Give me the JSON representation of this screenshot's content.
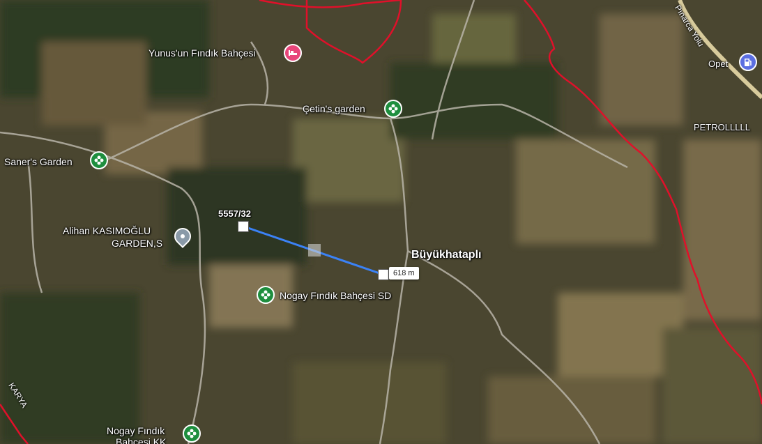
{
  "map": {
    "village_label": "Büyükhataplı",
    "parcel_label": "5557/32",
    "measurement": {
      "distance": "618 m"
    },
    "places": [
      {
        "name": "Yunus'un Fındık Bahçesi",
        "icon": "bed-icon",
        "color": "#e8457a"
      },
      {
        "name": "Çetin's garden",
        "icon": "flower-icon",
        "color": "#1e8e3e"
      },
      {
        "name": "Saner's Garden",
        "icon": "flower-icon",
        "color": "#1e8e3e"
      },
      {
        "name": "Alihan KASIMOĞLU",
        "line2": "GARDEN,S",
        "icon": "location-pin-icon",
        "color": "#8a9aa8"
      },
      {
        "name": "Nogay Fındık Bahçesi SD",
        "icon": "flower-icon",
        "color": "#1e8e3e"
      },
      {
        "name": "Nogay Fındık",
        "line2": "Bahçesi KK",
        "icon": "flower-icon",
        "color": "#1e8e3e"
      },
      {
        "name": "Opet",
        "icon": "fuel-icon",
        "color": "#5b6ee1"
      },
      {
        "name": "PETROLLLLL"
      }
    ],
    "roads": [
      {
        "name": "Pınarca Yolu"
      },
      {
        "name": "KARYA"
      }
    ],
    "colors": {
      "boundary": "#e0102a",
      "measure_line": "#3b82f6"
    }
  }
}
